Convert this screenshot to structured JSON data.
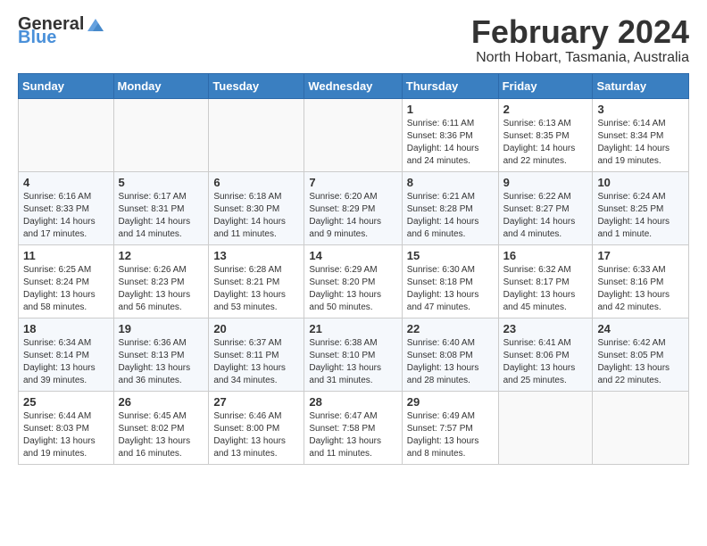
{
  "header": {
    "logo_general": "General",
    "logo_blue": "Blue",
    "main_title": "February 2024",
    "subtitle": "North Hobart, Tasmania, Australia"
  },
  "days_of_week": [
    "Sunday",
    "Monday",
    "Tuesday",
    "Wednesday",
    "Thursday",
    "Friday",
    "Saturday"
  ],
  "weeks": [
    [
      {
        "day": "",
        "info": ""
      },
      {
        "day": "",
        "info": ""
      },
      {
        "day": "",
        "info": ""
      },
      {
        "day": "",
        "info": ""
      },
      {
        "day": "1",
        "info": "Sunrise: 6:11 AM\nSunset: 8:36 PM\nDaylight: 14 hours\nand 24 minutes."
      },
      {
        "day": "2",
        "info": "Sunrise: 6:13 AM\nSunset: 8:35 PM\nDaylight: 14 hours\nand 22 minutes."
      },
      {
        "day": "3",
        "info": "Sunrise: 6:14 AM\nSunset: 8:34 PM\nDaylight: 14 hours\nand 19 minutes."
      }
    ],
    [
      {
        "day": "4",
        "info": "Sunrise: 6:16 AM\nSunset: 8:33 PM\nDaylight: 14 hours\nand 17 minutes."
      },
      {
        "day": "5",
        "info": "Sunrise: 6:17 AM\nSunset: 8:31 PM\nDaylight: 14 hours\nand 14 minutes."
      },
      {
        "day": "6",
        "info": "Sunrise: 6:18 AM\nSunset: 8:30 PM\nDaylight: 14 hours\nand 11 minutes."
      },
      {
        "day": "7",
        "info": "Sunrise: 6:20 AM\nSunset: 8:29 PM\nDaylight: 14 hours\nand 9 minutes."
      },
      {
        "day": "8",
        "info": "Sunrise: 6:21 AM\nSunset: 8:28 PM\nDaylight: 14 hours\nand 6 minutes."
      },
      {
        "day": "9",
        "info": "Sunrise: 6:22 AM\nSunset: 8:27 PM\nDaylight: 14 hours\nand 4 minutes."
      },
      {
        "day": "10",
        "info": "Sunrise: 6:24 AM\nSunset: 8:25 PM\nDaylight: 14 hours\nand 1 minute."
      }
    ],
    [
      {
        "day": "11",
        "info": "Sunrise: 6:25 AM\nSunset: 8:24 PM\nDaylight: 13 hours\nand 58 minutes."
      },
      {
        "day": "12",
        "info": "Sunrise: 6:26 AM\nSunset: 8:23 PM\nDaylight: 13 hours\nand 56 minutes."
      },
      {
        "day": "13",
        "info": "Sunrise: 6:28 AM\nSunset: 8:21 PM\nDaylight: 13 hours\nand 53 minutes."
      },
      {
        "day": "14",
        "info": "Sunrise: 6:29 AM\nSunset: 8:20 PM\nDaylight: 13 hours\nand 50 minutes."
      },
      {
        "day": "15",
        "info": "Sunrise: 6:30 AM\nSunset: 8:18 PM\nDaylight: 13 hours\nand 47 minutes."
      },
      {
        "day": "16",
        "info": "Sunrise: 6:32 AM\nSunset: 8:17 PM\nDaylight: 13 hours\nand 45 minutes."
      },
      {
        "day": "17",
        "info": "Sunrise: 6:33 AM\nSunset: 8:16 PM\nDaylight: 13 hours\nand 42 minutes."
      }
    ],
    [
      {
        "day": "18",
        "info": "Sunrise: 6:34 AM\nSunset: 8:14 PM\nDaylight: 13 hours\nand 39 minutes."
      },
      {
        "day": "19",
        "info": "Sunrise: 6:36 AM\nSunset: 8:13 PM\nDaylight: 13 hours\nand 36 minutes."
      },
      {
        "day": "20",
        "info": "Sunrise: 6:37 AM\nSunset: 8:11 PM\nDaylight: 13 hours\nand 34 minutes."
      },
      {
        "day": "21",
        "info": "Sunrise: 6:38 AM\nSunset: 8:10 PM\nDaylight: 13 hours\nand 31 minutes."
      },
      {
        "day": "22",
        "info": "Sunrise: 6:40 AM\nSunset: 8:08 PM\nDaylight: 13 hours\nand 28 minutes."
      },
      {
        "day": "23",
        "info": "Sunrise: 6:41 AM\nSunset: 8:06 PM\nDaylight: 13 hours\nand 25 minutes."
      },
      {
        "day": "24",
        "info": "Sunrise: 6:42 AM\nSunset: 8:05 PM\nDaylight: 13 hours\nand 22 minutes."
      }
    ],
    [
      {
        "day": "25",
        "info": "Sunrise: 6:44 AM\nSunset: 8:03 PM\nDaylight: 13 hours\nand 19 minutes."
      },
      {
        "day": "26",
        "info": "Sunrise: 6:45 AM\nSunset: 8:02 PM\nDaylight: 13 hours\nand 16 minutes."
      },
      {
        "day": "27",
        "info": "Sunrise: 6:46 AM\nSunset: 8:00 PM\nDaylight: 13 hours\nand 13 minutes."
      },
      {
        "day": "28",
        "info": "Sunrise: 6:47 AM\nSunset: 7:58 PM\nDaylight: 13 hours\nand 11 minutes."
      },
      {
        "day": "29",
        "info": "Sunrise: 6:49 AM\nSunset: 7:57 PM\nDaylight: 13 hours\nand 8 minutes."
      },
      {
        "day": "",
        "info": ""
      },
      {
        "day": "",
        "info": ""
      }
    ]
  ]
}
